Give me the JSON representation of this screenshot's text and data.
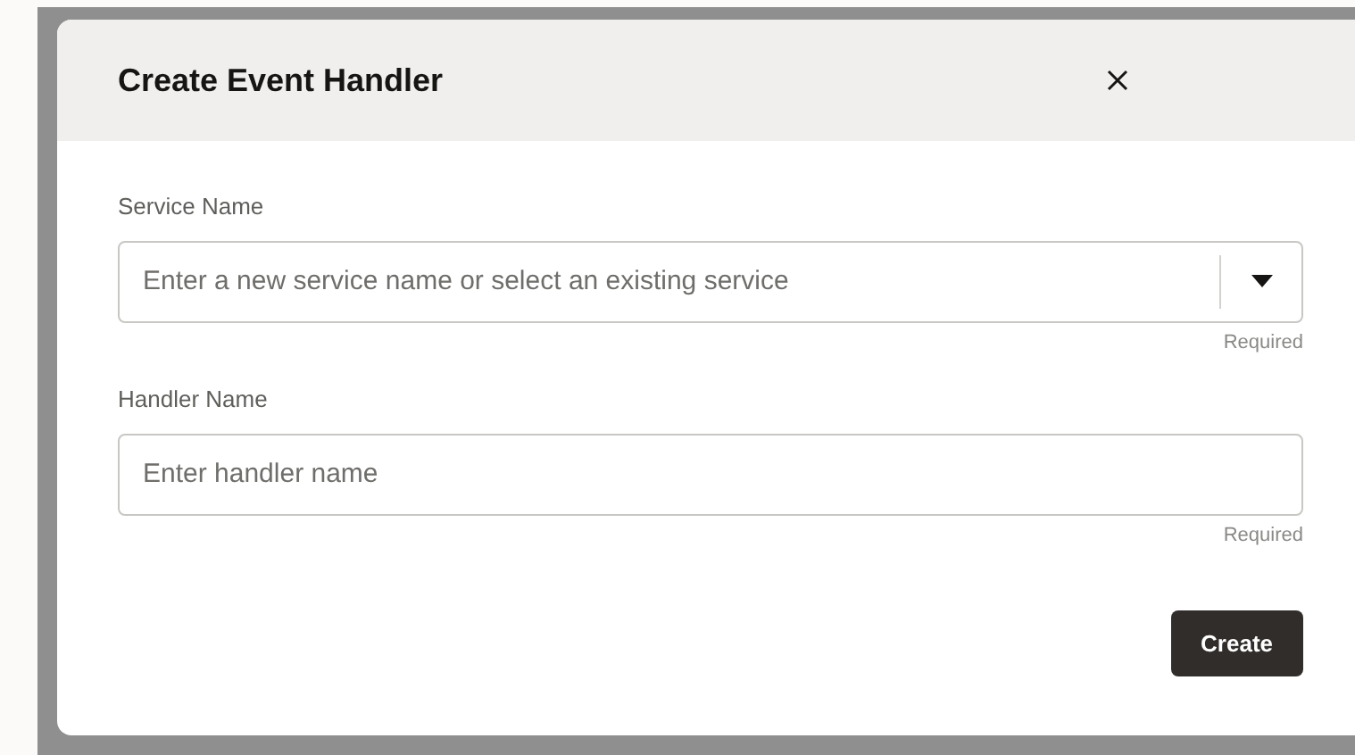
{
  "dialog": {
    "title": "Create Event Handler",
    "fields": [
      {
        "kind": "combobox",
        "label": "Service Name",
        "placeholder": "Enter a new service name or select an existing service",
        "hint": "Required"
      },
      {
        "kind": "text",
        "label": "Handler Name",
        "placeholder": "Enter handler name",
        "hint": "Required"
      }
    ],
    "buttons": [
      "Create"
    ]
  }
}
